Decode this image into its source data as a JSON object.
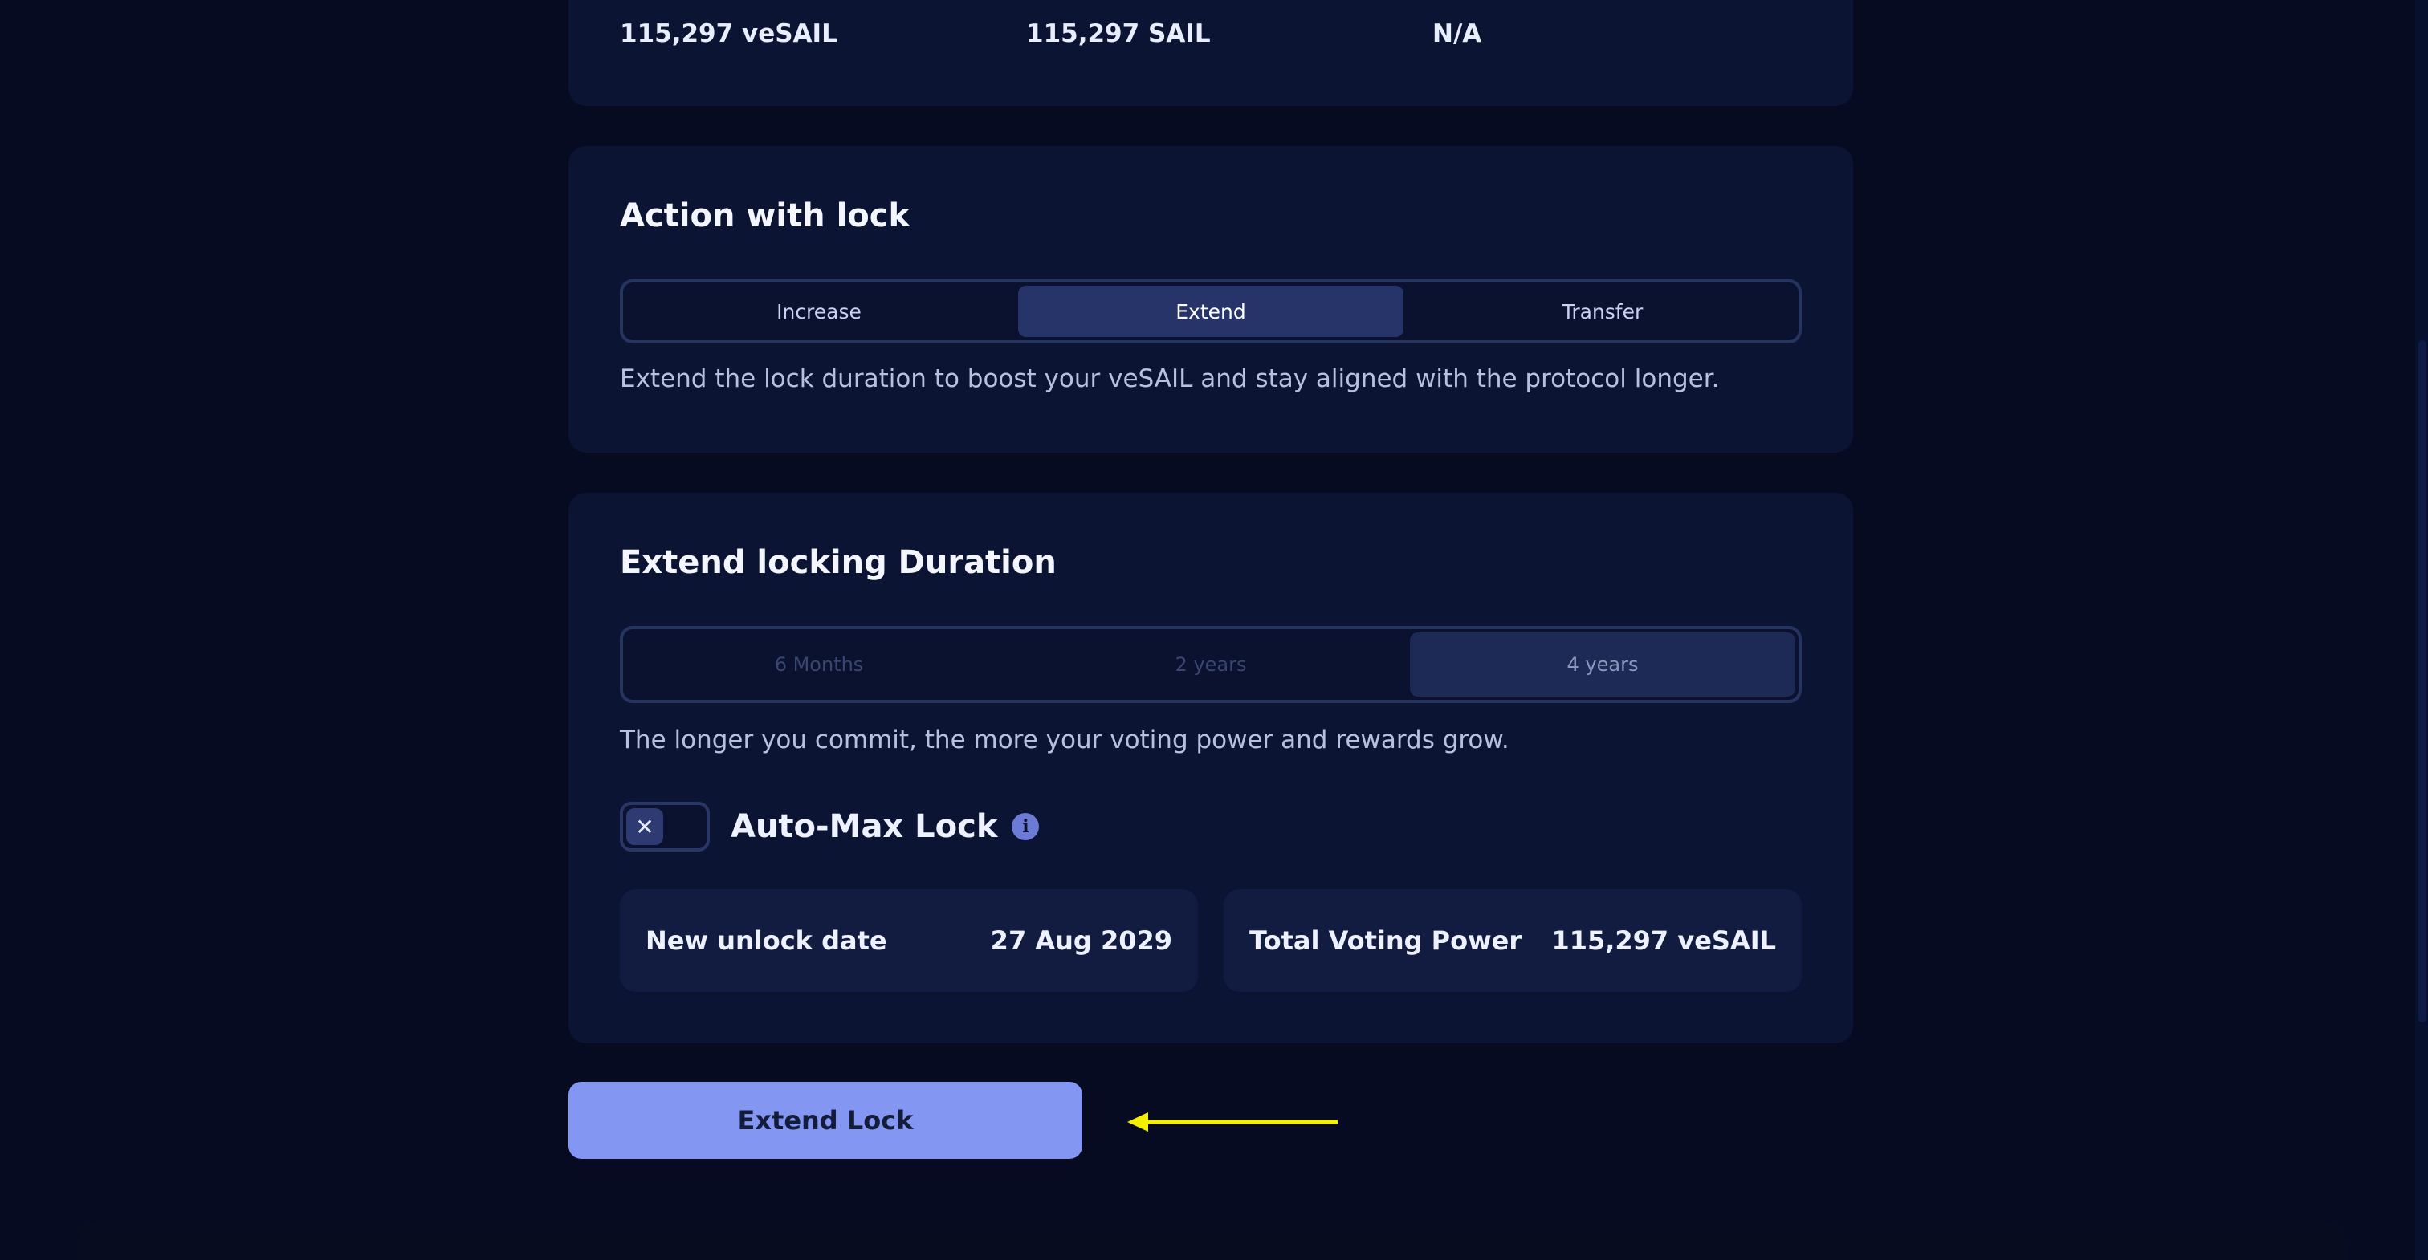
{
  "stats": {
    "vesail": "115,297 veSAIL",
    "sail": "115,297 SAIL",
    "extra": "N/A"
  },
  "action_card": {
    "title": "Action with lock",
    "tabs": [
      {
        "label": "Increase",
        "active": false
      },
      {
        "label": "Extend",
        "active": true
      },
      {
        "label": "Transfer",
        "active": false
      }
    ],
    "description": "Extend the lock duration to boost your veSAIL and stay aligned with the protocol longer."
  },
  "duration_card": {
    "title": "Extend locking Duration",
    "options": [
      {
        "label": "6 Months",
        "active": false
      },
      {
        "label": "2 years",
        "active": false
      },
      {
        "label": "4 years",
        "active": true
      }
    ],
    "description": "The longer you commit, the more your voting power and rewards grow.",
    "automax": {
      "label": "Auto-Max Lock",
      "toggle_icon": "close-icon",
      "info_icon": "info-icon"
    },
    "unlock": {
      "label": "New unlock date",
      "value": "27 Aug 2029"
    },
    "voting": {
      "label": "Total Voting Power",
      "value": "115,297 veSAIL"
    }
  },
  "primary_button": {
    "label": "Extend Lock"
  },
  "colors": {
    "background": "#060b22",
    "card": "#0c1434",
    "accent": "#8396f2",
    "annotation_arrow": "#f4f000"
  }
}
